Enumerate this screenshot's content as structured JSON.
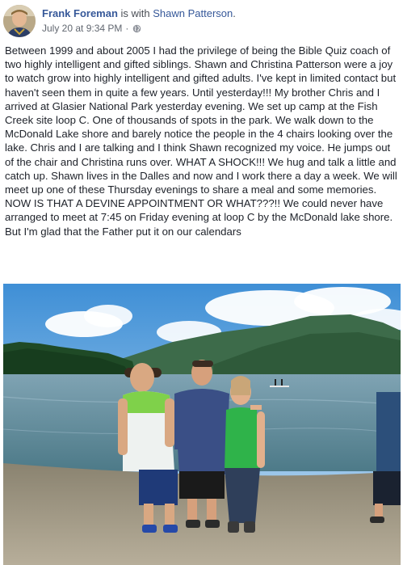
{
  "post": {
    "author_name": "Frank Foreman",
    "with_text": " is with ",
    "tagged_name": "Shawn Patterson",
    "tagged_suffix": ".",
    "timestamp": "July 20 at 9:34 PM",
    "separator": "·",
    "privacy_icon": "globe-icon",
    "body": "Between 1999 and about 2005 I had the privilege of being the Bible Quiz coach of two highly intelligent and gifted siblings. Shawn and Christina Patterson were a joy to watch grow into highly intelligent and gifted adults. I've kept in limited contact but haven't seen them in quite a few years. Until yesterday!!! My brother Chris and I arrived at Glasier National Park yesterday evening. We set up camp at the Fish Creek site loop C. One of thousands of spots in the park. We walk down to the McDonald Lake shore and barely notice the people in the 4 chairs looking over the lake. Chris and I are talking and I think Shawn recognized my voice. He jumps out of the chair and Christina runs over. WHAT A SHOCK!!! We hug and talk a little and catch up. Shawn lives in the Dalles and now and I work there a day a week. We will meet up one of these Thursday evenings to share a meal and some memories. NOW IS THAT A DEVINE APPOINTMENT OR WHAT???!! We could never have arranged to meet at 7:45 on Friday evening at loop C by the McDonald lake shore. But I'm glad that the Father put it on our calendars"
  },
  "colors": {
    "link_blue": "#365899",
    "text": "#1d2129",
    "meta_gray": "#616770"
  }
}
